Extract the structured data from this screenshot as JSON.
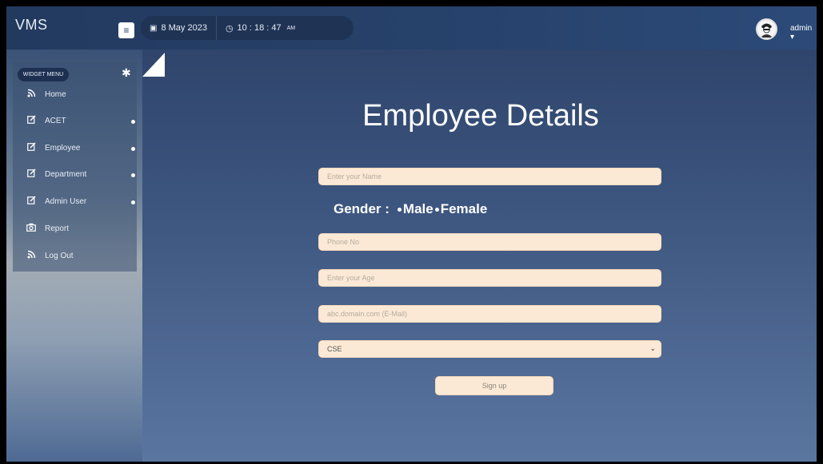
{
  "app": {
    "brand": "VMS"
  },
  "topbar": {
    "date": "8 May 2023",
    "time": "10 : 18 : 47",
    "ampm": "AM",
    "user": "admin ▾"
  },
  "sidebar": {
    "widget_menu_label": "WIDGET MENU",
    "items": [
      {
        "label": "Home",
        "icon": "rss-icon",
        "has_dot": false
      },
      {
        "label": "ACET",
        "icon": "edit-icon",
        "has_dot": true
      },
      {
        "label": "Employee",
        "icon": "edit-icon",
        "has_dot": true
      },
      {
        "label": "Department",
        "icon": "edit-icon",
        "has_dot": true
      },
      {
        "label": "Admin User",
        "icon": "edit-icon",
        "has_dot": true
      },
      {
        "label": "Report",
        "icon": "camera-icon",
        "has_dot": false
      },
      {
        "label": "Log Out",
        "icon": "rss-icon",
        "has_dot": false
      }
    ]
  },
  "form": {
    "title": "Employee Details",
    "name_placeholder": "Enter your Name",
    "gender_label": "Gender :",
    "gender_options": [
      "Male",
      "Female"
    ],
    "phone_placeholder": "Phone No",
    "age_placeholder": "Enter your Age",
    "email_placeholder": "abc.domain.com (E-Mail)",
    "department_selected": "CSE",
    "submit_label": "Sign up"
  },
  "colors": {
    "field_bg": "#fbe9d6",
    "topbar": "#233a5f",
    "accent_white": "#ffffff"
  }
}
